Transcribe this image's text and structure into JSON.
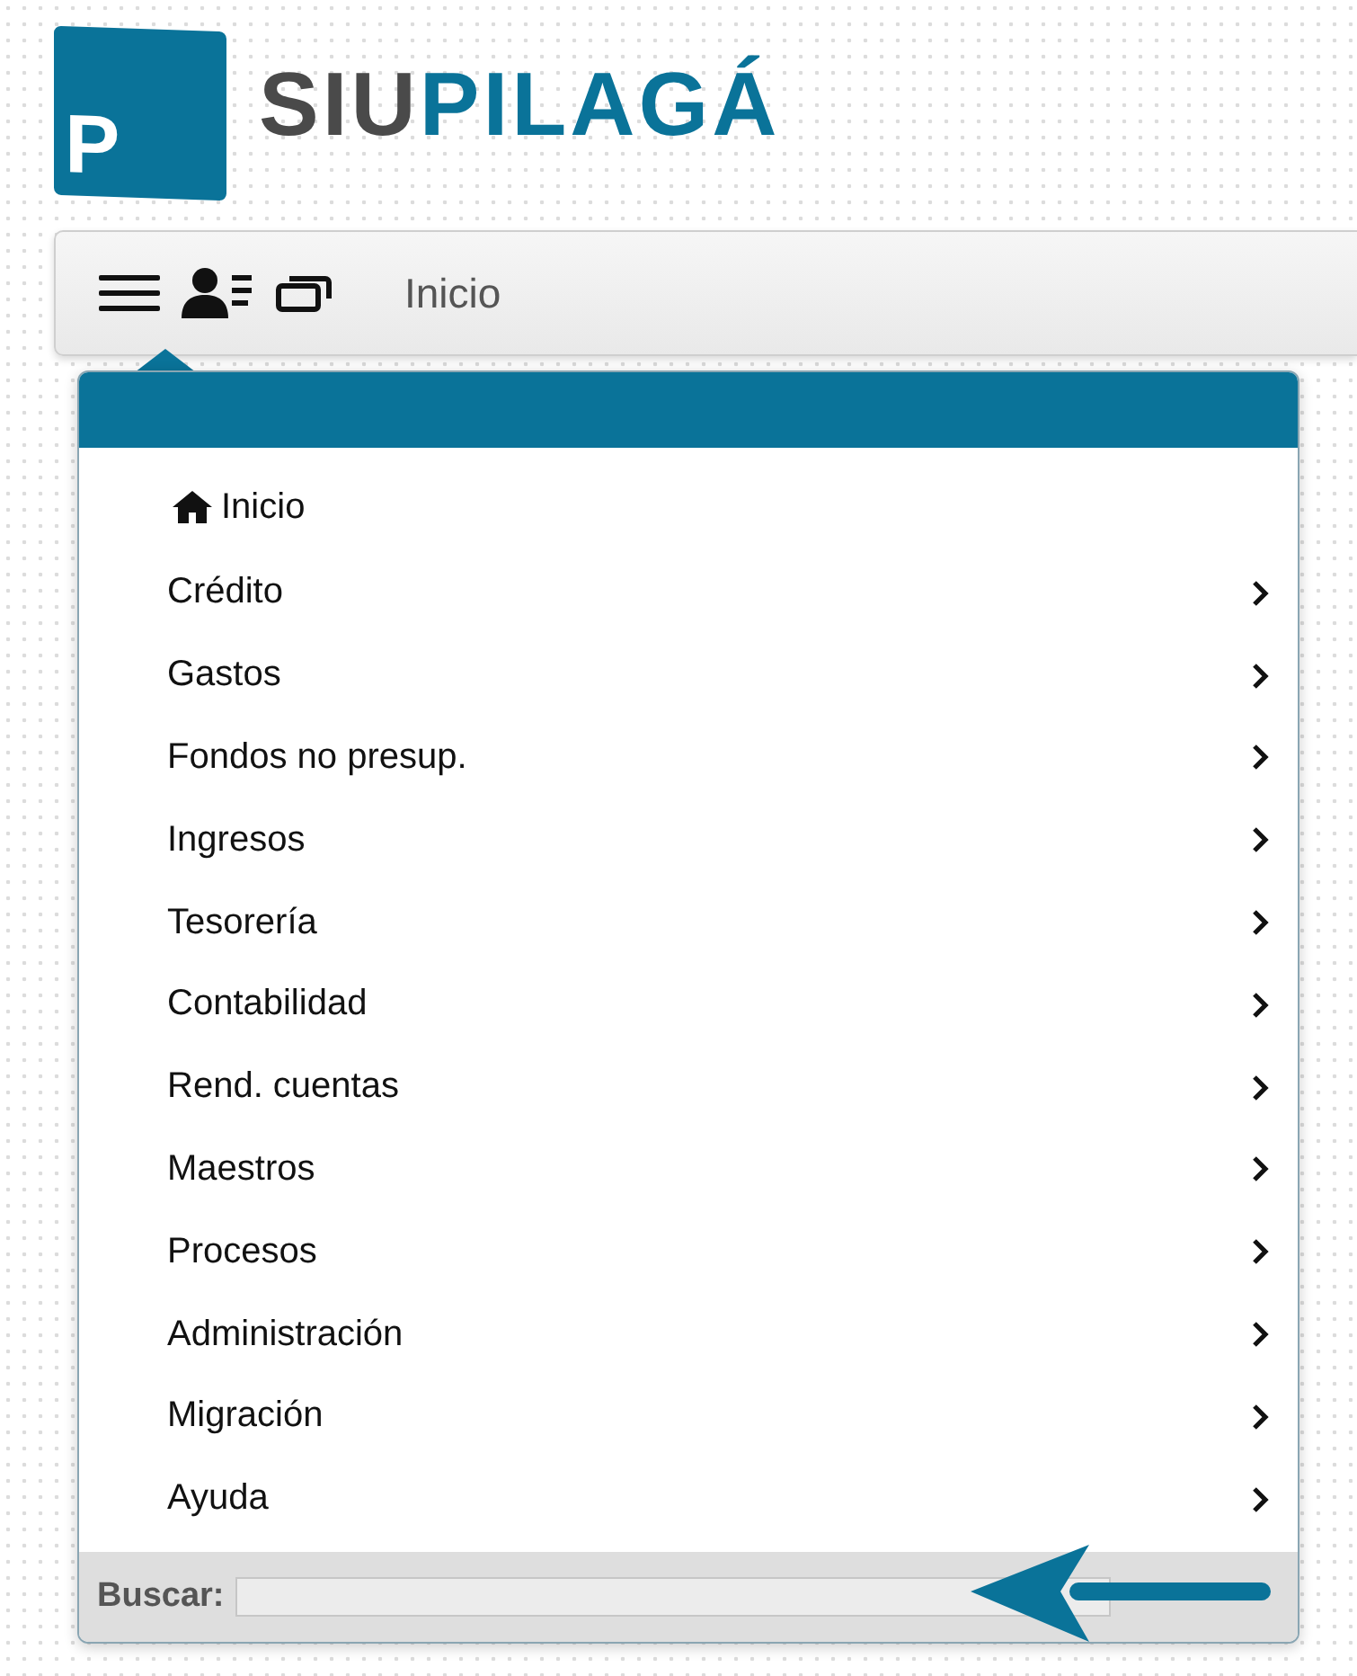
{
  "logo": {
    "icon_letter": "P",
    "name_part_1": "SIU",
    "name_part_2": "PILAGÁ"
  },
  "navbar": {
    "breadcrumb": "Inicio"
  },
  "menu": {
    "items": [
      {
        "label": "Inicio",
        "kind": "home"
      },
      {
        "label": "Crédito",
        "kind": "submenu"
      },
      {
        "label": "Gastos",
        "kind": "submenu"
      },
      {
        "label": "Fondos no presup.",
        "kind": "submenu"
      },
      {
        "label": "Ingresos",
        "kind": "submenu"
      },
      {
        "label": "Tesorería",
        "kind": "submenu"
      },
      {
        "label": "Contabilidad",
        "kind": "submenu"
      },
      {
        "label": "Rend. cuentas",
        "kind": "submenu"
      },
      {
        "label": "Maestros",
        "kind": "submenu"
      },
      {
        "label": "Procesos",
        "kind": "submenu"
      },
      {
        "label": "Administración",
        "kind": "submenu"
      },
      {
        "label": "Migración",
        "kind": "submenu"
      },
      {
        "label": "Ayuda",
        "kind": "submenu"
      }
    ],
    "search_label": "Buscar:"
  }
}
